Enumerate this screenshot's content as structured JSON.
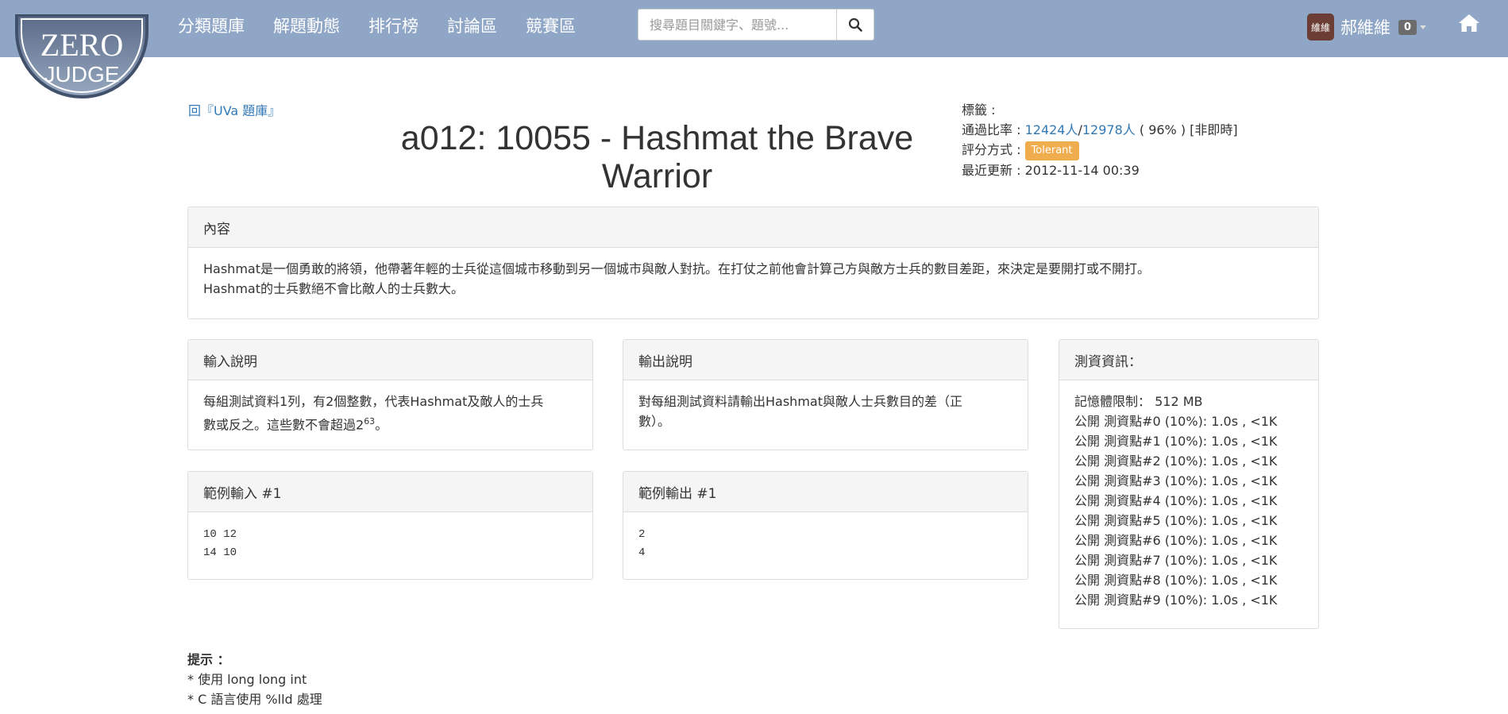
{
  "logo": {
    "line1": "ZERO",
    "line2": "JUDGE"
  },
  "nav": {
    "items": [
      {
        "label": "分類題庫"
      },
      {
        "label": "解題動態"
      },
      {
        "label": "排行榜"
      },
      {
        "label": "討論區"
      },
      {
        "label": "競賽區"
      }
    ],
    "search_placeholder": "搜尋題目關鍵字、題號...",
    "user": {
      "avatar_text": "維維",
      "name": "郝維維",
      "count": "0"
    }
  },
  "back_link": "回『UVa 題庫』",
  "problem": {
    "title": "a012: 10055 - Hashmat the Brave Warrior"
  },
  "meta": {
    "tags_label": "標籤 :",
    "pass_label": "通過比率 : ",
    "passed": "12424人",
    "slash": "/",
    "attempted": "12978人",
    "percent": " ( 96% ) [非即時]",
    "scoring_label": "評分方式 : ",
    "scoring": "Tolerant",
    "updated_label": "最近更新 : ",
    "updated": "2012-11-14 00:39"
  },
  "content": {
    "heading": "內容",
    "line1": "Hashmat是一個勇敢的將領，他帶著年輕的士兵從這個城市移動到另一個城市與敵人對抗。在打仗之前他會計算己方與敵方士兵的數目差距，來決定是要開打或不開打。",
    "line2": "Hashmat的士兵數絕不會比敵人的士兵數大。"
  },
  "input_desc": {
    "heading": "輸入說明",
    "line1": "每組測試資料1列，有2個整數，代表Hashmat及敵人的士兵",
    "line2_prefix": "數或反之。這些數不會超過2",
    "sup": "63",
    "line2_suffix": "。"
  },
  "output_desc": {
    "heading": "輸出說明",
    "line1": "對每組測試資料請輸出Hashmat與敵人士兵數目的差（正",
    "line2": "數）。"
  },
  "sample_input": {
    "heading": "範例輸入 #1",
    "lines": [
      "10 12",
      "14 10"
    ]
  },
  "sample_output": {
    "heading": "範例輸出 #1",
    "lines": [
      "2",
      "4"
    ]
  },
  "testdata": {
    "heading": "測資資訊：",
    "memory": "記憶體限制： 512 MB",
    "cases": [
      "公開 測資點#0 (10%): 1.0s , <1K",
      "公開 測資點#1 (10%): 1.0s , <1K",
      "公開 測資點#2 (10%): 1.0s , <1K",
      "公開 測資點#3 (10%): 1.0s , <1K",
      "公開 測資點#4 (10%): 1.0s , <1K",
      "公開 測資點#5 (10%): 1.0s , <1K",
      "公開 測資點#6 (10%): 1.0s , <1K",
      "公開 測資點#7 (10%): 1.0s , <1K",
      "公開 測資點#8 (10%): 1.0s , <1K",
      "公開 測資點#9 (10%): 1.0s , <1K"
    ]
  },
  "hint": {
    "title": "提示 ：",
    "lines": [
      "* 使用 long long int",
      "* C 語言使用 %lld 處理"
    ]
  },
  "colors": {
    "navbar": "#8fa6c7",
    "link": "#337ab7",
    "tolerant": "#f0ad4e"
  }
}
